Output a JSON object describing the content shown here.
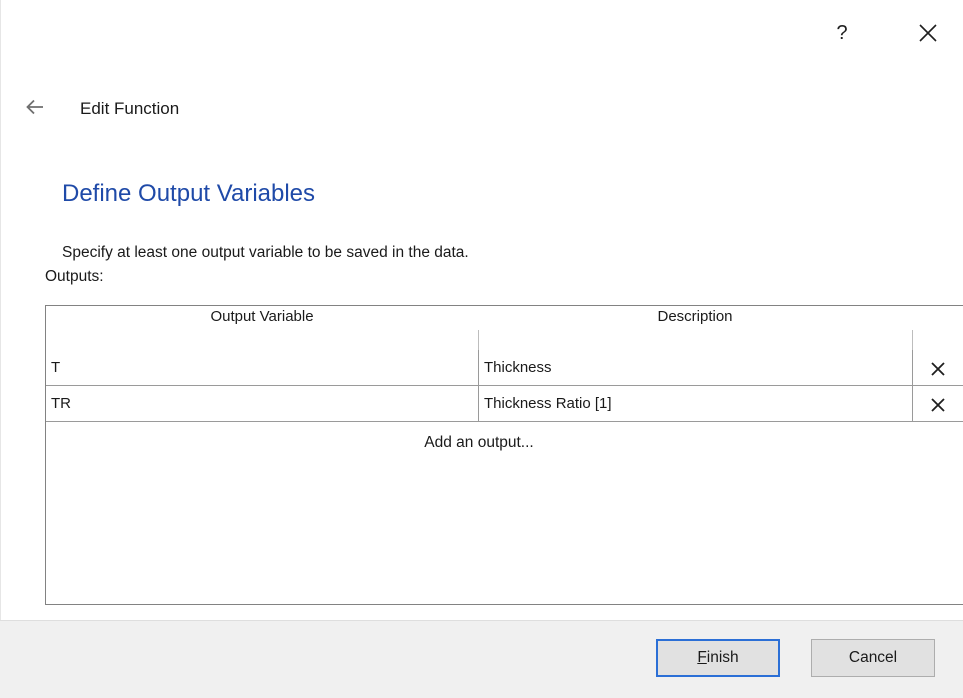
{
  "titlebar": {
    "help_label": "?",
    "close_icon": "close-icon"
  },
  "header": {
    "back_icon": "arrow-left-icon",
    "title": "Edit Function"
  },
  "page": {
    "heading": "Define Output Variables",
    "instruction": "Specify at least one output variable to be saved in the data.",
    "outputs_label": "Outputs:"
  },
  "table": {
    "columns": [
      "Output Variable",
      "Description"
    ],
    "rows": [
      {
        "variable": "T",
        "description": "Thickness"
      },
      {
        "variable": "TR",
        "description": "Thickness Ratio [1]"
      }
    ],
    "add_label": "Add an output..."
  },
  "footer": {
    "finish_first": "F",
    "finish_rest": "inish",
    "cancel_label": "Cancel"
  },
  "colors": {
    "heading": "#1f4aa8",
    "default_button_border": "#2b6fd6",
    "footer_bg": "#f0f0f0"
  }
}
